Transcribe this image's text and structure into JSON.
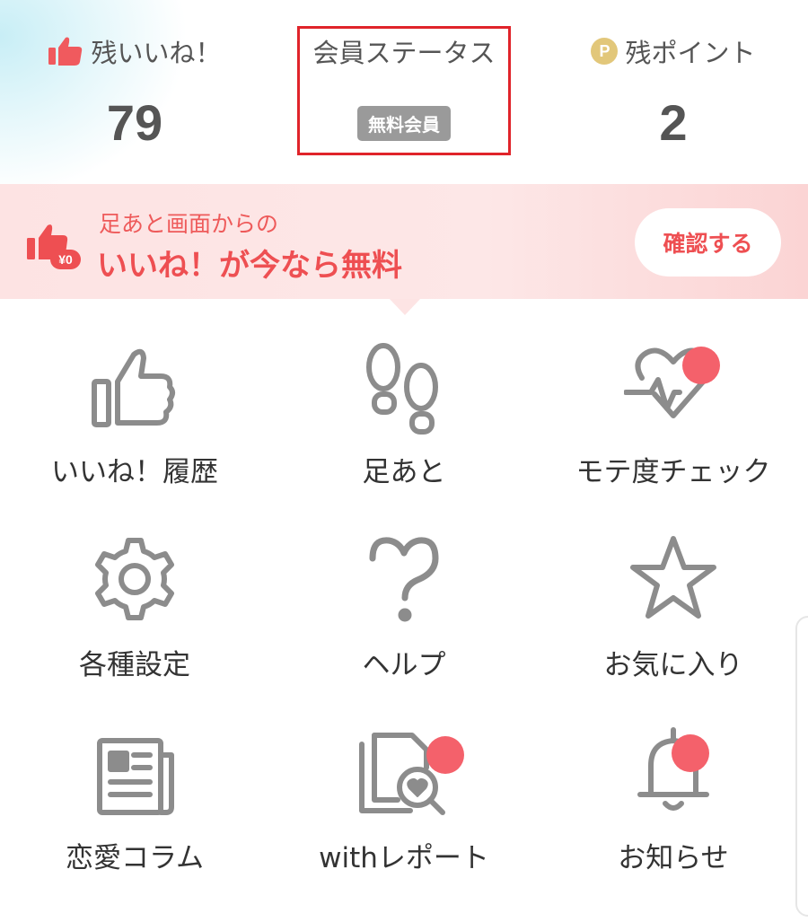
{
  "stats": {
    "likes": {
      "label": "残いいね！",
      "value": "79"
    },
    "status": {
      "label": "会員ステータス",
      "badge": "無料会員"
    },
    "points": {
      "label": "残ポイント",
      "icon_text": "P",
      "value": "2"
    }
  },
  "promo": {
    "subtitle": "足あと画面からの",
    "title": "いいね！が今なら無料",
    "icon_text": "¥0",
    "button_label": "確認する"
  },
  "menu": [
    {
      "label": "いいね！履歴",
      "icon": "thumbs-up-icon",
      "badge": false
    },
    {
      "label": "足あと",
      "icon": "footprints-icon",
      "badge": false
    },
    {
      "label": "モテ度チェック",
      "icon": "heart-pulse-icon",
      "badge": true
    },
    {
      "label": "各種設定",
      "icon": "gear-icon",
      "badge": false
    },
    {
      "label": "ヘルプ",
      "icon": "question-icon",
      "badge": false
    },
    {
      "label": "お気に入り",
      "icon": "star-icon",
      "badge": false
    },
    {
      "label": "恋愛コラム",
      "icon": "newspaper-icon",
      "badge": false
    },
    {
      "label": "withレポート",
      "icon": "report-search-icon",
      "badge": true
    },
    {
      "label": "お知らせ",
      "icon": "bell-icon",
      "badge": true
    }
  ],
  "colors": {
    "accent": "#ee4f52",
    "badge_dot": "#f4616b",
    "icon_gray": "#8c8c8c",
    "status_badge": "#9a9a9a",
    "highlight_box": "#e0242a"
  }
}
